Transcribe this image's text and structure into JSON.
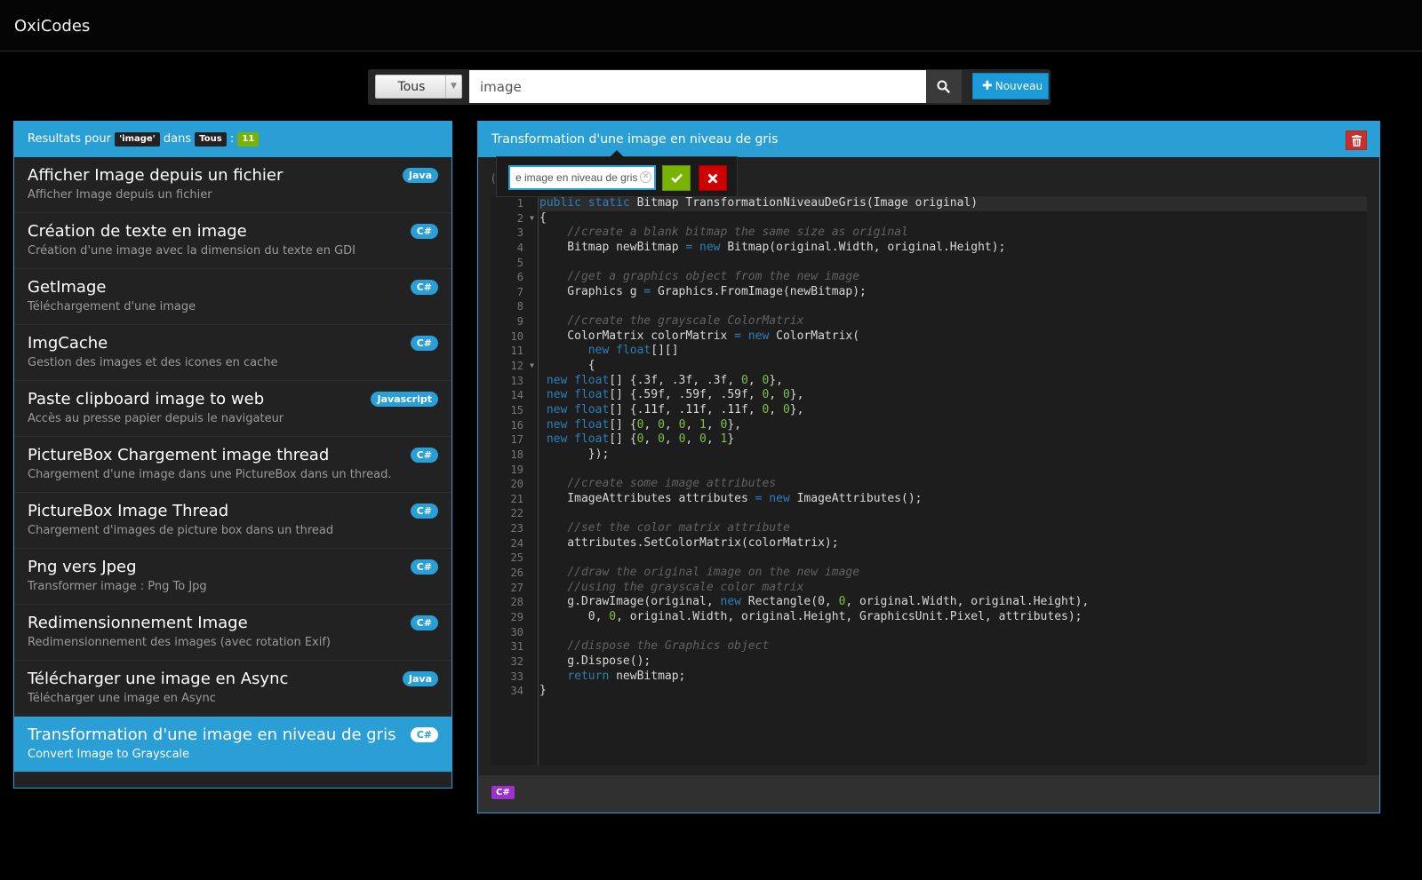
{
  "app": {
    "title": "OxiCodes"
  },
  "search": {
    "category": "Tous",
    "query": "image",
    "new_label": "Nouveau"
  },
  "results": {
    "prefix": "Resultats pour",
    "query_tag": "'image'",
    "dans": "dans",
    "category_tag": "Tous",
    "colon": ":",
    "count": "11",
    "items": [
      {
        "title": "Afficher Image depuis un fichier",
        "sub": "Afficher Image depuis un fichier",
        "lang": "Java"
      },
      {
        "title": "Création de texte en image",
        "sub": "Création d'une image avec la dimension du texte en GDI",
        "lang": "C#"
      },
      {
        "title": "GetImage",
        "sub": "Téléchargement d'une image",
        "lang": "C#"
      },
      {
        "title": "ImgCache",
        "sub": "Gestion des images et des icones en cache",
        "lang": "C#"
      },
      {
        "title": "Paste clipboard image to web",
        "sub": "Accès au presse papier depuis le navigateur",
        "lang": "Javascript"
      },
      {
        "title": "PictureBox Chargement image thread",
        "sub": "Chargement d'une image dans une PictureBox dans un thread.",
        "lang": "C#"
      },
      {
        "title": "PictureBox Image Thread",
        "sub": "Chargement d'images de picture box dans un thread",
        "lang": "C#"
      },
      {
        "title": "Png vers Jpeg",
        "sub": "Transformer image : Png To Jpg",
        "lang": "C#"
      },
      {
        "title": "Redimensionnement Image",
        "sub": "Redimensionnement des images (avec rotation Exif)",
        "lang": "C#"
      },
      {
        "title": "Télécharger une image en Async",
        "sub": "Télécharger une image en Async",
        "lang": "Java"
      },
      {
        "title": "Transformation d'une image en niveau de gris",
        "sub": "Convert Image to Grayscale",
        "lang": "C#",
        "active": true
      }
    ]
  },
  "detail": {
    "title": "Transformation d'une image en niveau de gris",
    "rename_value": "e image en niveau de gris",
    "hint": "(",
    "language": "C#",
    "code_lines": [
      "public static Bitmap TransformationNiveauDeGris(Image original)",
      "{",
      "    //create a blank bitmap the same size as original",
      "    Bitmap newBitmap = new Bitmap(original.Width, original.Height);",
      "",
      "    //get a graphics object from the new image",
      "    Graphics g = Graphics.FromImage(newBitmap);",
      "",
      "    //create the grayscale ColorMatrix",
      "    ColorMatrix colorMatrix = new ColorMatrix(",
      "       new float[][]",
      "       {",
      " new float[] {.3f, .3f, .3f, 0, 0},",
      " new float[] {.59f, .59f, .59f, 0, 0},",
      " new float[] {.11f, .11f, .11f, 0, 0},",
      " new float[] {0, 0, 0, 1, 0},",
      " new float[] {0, 0, 0, 0, 1}",
      "       });",
      "",
      "    //create some image attributes",
      "    ImageAttributes attributes = new ImageAttributes();",
      "",
      "    //set the color matrix attribute",
      "    attributes.SetColorMatrix(colorMatrix);",
      "",
      "    //draw the original image on the new image",
      "    //using the grayscale color matrix",
      "    g.DrawImage(original, new Rectangle(0, 0, original.Width, original.Height),",
      "       0, 0, original.Width, original.Height, GraphicsUnit.Pixel, attributes);",
      "",
      "    //dispose the Graphics object",
      "    g.Dispose();",
      "    return newBitmap;",
      "}"
    ],
    "fold_lines": [
      2,
      12
    ]
  },
  "colors": {
    "accent": "#2a9fd6",
    "success": "#77b300",
    "danger": "#cc0000",
    "lang_label": "#9933cc",
    "background": "#000000"
  },
  "icons": [
    "search-icon",
    "plus-icon",
    "trash-icon",
    "check-icon",
    "close-icon",
    "clear-icon",
    "chevron-down-icon"
  ]
}
